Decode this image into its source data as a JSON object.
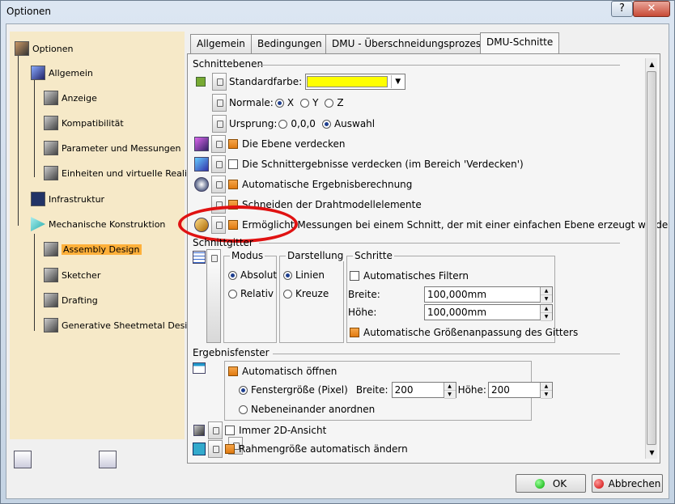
{
  "window": {
    "title": "Optionen",
    "help_glyph": "?",
    "close_glyph": "✕"
  },
  "tree": {
    "root": "Optionen",
    "allgemein": "Allgemein",
    "anzeige": "Anzeige",
    "kompatibilitaet": "Kompatibilität",
    "parameter": "Parameter und Messungen",
    "einheiten": "Einheiten und virtuelle Realit",
    "infrastruktur": "Infrastruktur",
    "mechanische": "Mechanische Konstruktion",
    "assembly": "Assembly Design",
    "sketcher": "Sketcher",
    "drafting": "Drafting",
    "sheetmetal": "Generative Sheetmetal Desig"
  },
  "tabs": [
    "Allgemein",
    "Bedingungen",
    "DMU - Überschneidungsprozess",
    "DMU-Schnitte"
  ],
  "schnittebenen": {
    "title": "Schnittebenen",
    "standardfarbe": "Standardfarbe:",
    "farbe_hex": "#ffff00",
    "normale": "Normale:",
    "normale_x": "X",
    "normale_y": "Y",
    "normale_z": "Z",
    "ursprung": "Ursprung:",
    "ursprung_000": "0,0,0",
    "ursprung_auswahl": "Auswahl",
    "ebene_verdecken": "Die Ebene verdecken",
    "schnitt_verdecken": "Die Schnittergebnisse verdecken (im Bereich 'Verdecken')",
    "auto_ergebnis": "Automatische Ergebnisberechnung",
    "draht": "Schneiden der Drahtmodellelemente",
    "messungen": "Ermöglicht Messungen bei einem Schnitt, der mit einer einfachen Ebene erzeugt wurde"
  },
  "schnittgitter": {
    "title": "Schnittgitter",
    "modus": "Modus",
    "absolut": "Absolut",
    "relativ": "Relativ",
    "darstellung": "Darstellung",
    "linien": "Linien",
    "kreuze": "Kreuze",
    "schritte": "Schritte",
    "auto_filtern": "Automatisches Filtern",
    "breite": "Breite:",
    "breite_val": "100,000mm",
    "hoehe": "Höhe:",
    "hoehe_val": "100,000mm",
    "auto_groesse": "Automatische Größenanpassung des Gitters"
  },
  "ergebnisfenster": {
    "title": "Ergebnisfenster",
    "auto_oeffnen": "Automatisch öffnen",
    "fenstergroesse": "Fenstergröße (Pixel)",
    "breite": "Breite:",
    "breite_val": "200",
    "hoehe": "Höhe:",
    "hoehe_val": "200",
    "nebeneinander": "Nebeneinander anordnen",
    "immer_2d": "Immer 2D-Ansicht",
    "rahmen": "Rahmengröße automatisch ändern"
  },
  "buttons": {
    "ok": "OK",
    "abbrechen": "Abbrechen"
  },
  "colors": {
    "accent_orange": "#e07a10",
    "selection": "#ffb03a",
    "annotation_ring": "#e01212"
  }
}
